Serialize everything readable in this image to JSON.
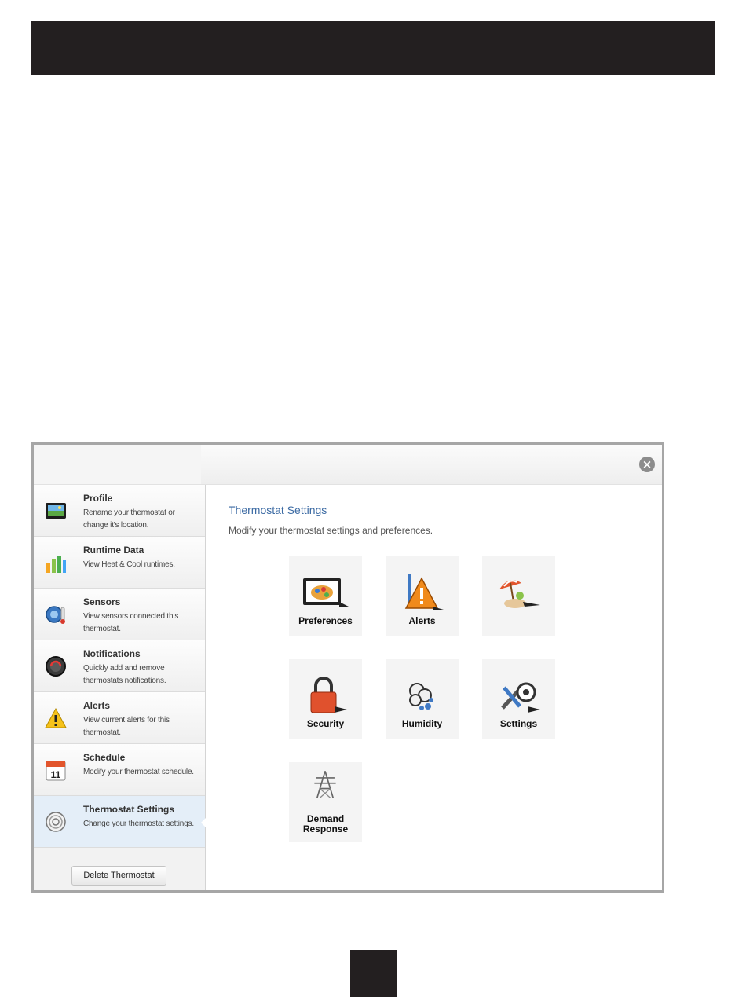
{
  "sidebar": {
    "items": [
      {
        "title": "Profile",
        "desc": "Rename your thermostat or change it's location."
      },
      {
        "title": "Runtime Data",
        "desc": "View Heat & Cool runtimes."
      },
      {
        "title": "Sensors",
        "desc": "View sensors connected this thermostat."
      },
      {
        "title": "Notifications",
        "desc": "Quickly add and remove thermostats notifications."
      },
      {
        "title": "Alerts",
        "desc": "View current alerts for this thermostat."
      },
      {
        "title": "Schedule",
        "desc": "Modify your thermostat schedule."
      },
      {
        "title": "Thermostat Settings",
        "desc": "Change your thermostat settings."
      }
    ],
    "delete_label": "Delete Thermostat",
    "schedule_icon_number": "11"
  },
  "main": {
    "title": "Thermostat Settings",
    "subtitle": "Modify your thermostat settings and preferences.",
    "tiles": [
      {
        "label": "Preferences",
        "icon": "preferences-icon"
      },
      {
        "label": "Alerts",
        "icon": "alert-warning-icon"
      },
      {
        "label": "",
        "icon": "vacation-umbrella-icon"
      },
      {
        "label": "Security",
        "icon": "padlock-icon"
      },
      {
        "label": "Humidity",
        "icon": "humidity-droplets-icon"
      },
      {
        "label": "Settings",
        "icon": "wrench-gear-icon"
      },
      {
        "label": "Demand Response",
        "icon": "power-tower-icon"
      }
    ]
  },
  "header": {
    "close_symbol": "×"
  },
  "colors": {
    "title_blue": "#3b6aa3",
    "active_item": "#e4eef8",
    "alert_orange": "#f08a1c",
    "lock_orange": "#e0512d"
  }
}
